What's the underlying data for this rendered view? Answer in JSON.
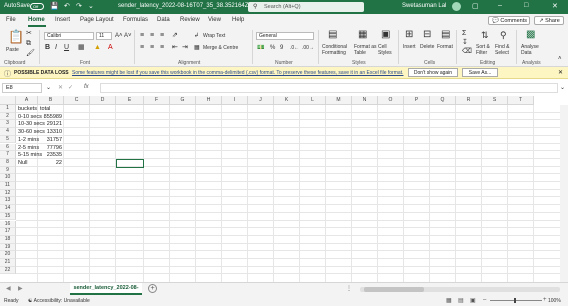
{
  "titlebar": {
    "autosave_label": "AutoSave",
    "autosave_state": "Off",
    "doc_title": "sender_latency_2022-08-16T07_35_38.352164Z",
    "search_placeholder": "Search (Alt+Q)",
    "user_name": "Swetasuman Lal"
  },
  "menu": {
    "tabs": [
      "File",
      "Home",
      "Insert",
      "Page Layout",
      "Formulas",
      "Data",
      "Review",
      "View",
      "Help"
    ],
    "active": "Home",
    "comments_label": "Comments",
    "share_label": "Share"
  },
  "ribbon": {
    "paste_label": "Paste",
    "font_name": "Calibri",
    "font_size": "11",
    "wrap_text_label": "Wrap Text",
    "merge_center_label": "Merge & Centre",
    "number_format": "General",
    "conditional_formatting_label": "Conditional Formatting",
    "format_as_table_label": "Format as Table",
    "cell_styles_label": "Cell Styles",
    "insert_label": "Insert",
    "delete_label": "Delete",
    "format_label": "Format",
    "sort_filter_label": "Sort & Filter",
    "find_select_label": "Find & Select",
    "analyse_data_label": "Analyse Data",
    "groups": [
      "Clipboard",
      "Font",
      "Alignment",
      "Number",
      "Styles",
      "Cells",
      "Editing",
      "Analysis"
    ]
  },
  "notification": {
    "heading": "POSSIBLE DATA LOSS",
    "message": "Some features might be lost if you save this workbook in the comma-delimited (.csv) format. To preserve these features, save it in an Excel file format.",
    "dont_show_label": "Don't show again",
    "save_as_label": "Save As..."
  },
  "formula_bar": {
    "name_box": "E8",
    "fx_label": "fx",
    "formula": ""
  },
  "grid": {
    "columns": [
      "A",
      "B",
      "C",
      "D",
      "E",
      "F",
      "G",
      "H",
      "I",
      "J",
      "K",
      "L",
      "M",
      "N",
      "O",
      "P",
      "Q",
      "R",
      "S",
      "T"
    ],
    "row_numbers": [
      "1",
      "2",
      "3",
      "4",
      "5",
      "6",
      "7",
      "8",
      "9",
      "10",
      "11",
      "12",
      "13",
      "14",
      "15",
      "16",
      "17",
      "18",
      "19",
      "20",
      "21",
      "22"
    ],
    "rows": [
      {
        "a": "buckets",
        "b": "total"
      },
      {
        "a": "0-10 secs",
        "b": "855989"
      },
      {
        "a": "10-30 secs",
        "b": "29121"
      },
      {
        "a": "30-60 secs",
        "b": "13310"
      },
      {
        "a": "1-2 mins",
        "b": "31757"
      },
      {
        "a": "2-5 mins",
        "b": "77796"
      },
      {
        "a": "5-15 mins",
        "b": "23535"
      },
      {
        "a": "Null",
        "b": "22"
      }
    ],
    "selected_cell": "E8"
  },
  "sheets": {
    "tabs": [
      "sender_latency_2022-08-16T07_35"
    ],
    "active": "sender_latency_2022-08-16T07_35"
  },
  "status": {
    "ready": "Ready",
    "accessibility": "Accessibility: Unavailable",
    "zoom": "100%"
  }
}
